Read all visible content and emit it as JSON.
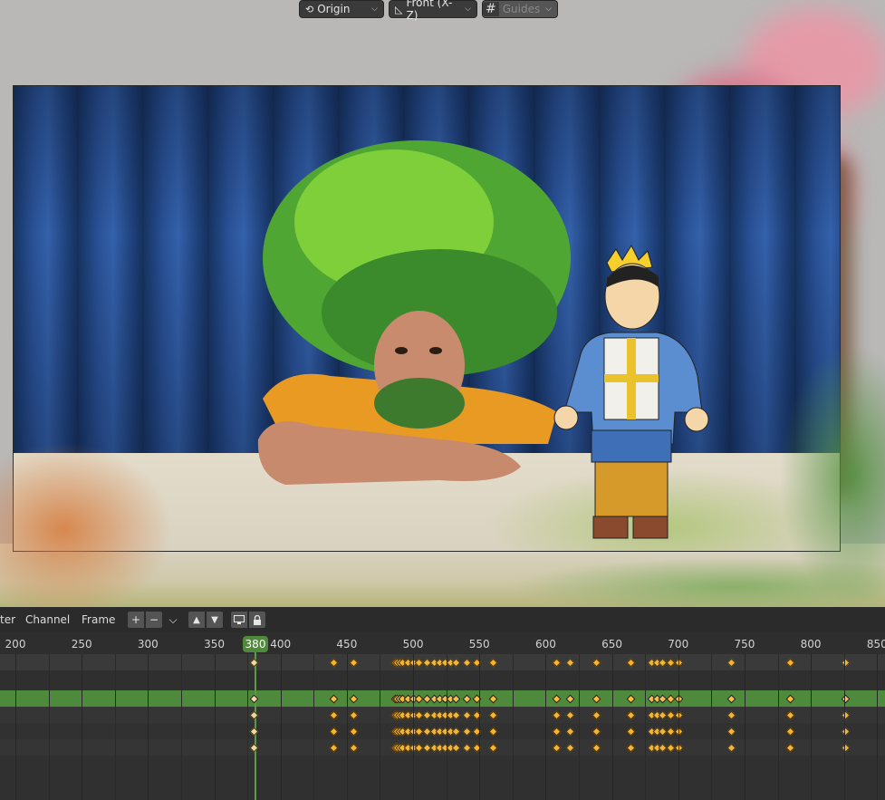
{
  "viewport_header": {
    "pivot_label": "Origin",
    "view_label": "Front (X-Z)",
    "guides_label": "Guides"
  },
  "timeline_header": {
    "menu_partial": "ter",
    "menu_channel": "Channel",
    "menu_frame": "Frame",
    "btn_add": "+",
    "btn_remove": "−",
    "btn_dropdown": "⌵",
    "btn_up": "▲",
    "btn_down": "▼"
  },
  "ruler": {
    "labels": [
      "200",
      "250",
      "300",
      "350",
      "400",
      "450",
      "500",
      "550",
      "600",
      "650",
      "700",
      "750",
      "800",
      "850"
    ],
    "current_frame": "380"
  },
  "keyframes": {
    "frames": [
      380,
      440,
      455,
      486,
      488,
      490,
      492,
      496,
      500,
      504,
      510,
      516,
      520,
      524,
      528,
      532,
      540,
      548,
      560,
      608,
      618,
      638,
      664,
      680,
      684,
      688,
      694,
      700,
      740,
      784,
      826
    ],
    "rows": [
      "summary",
      "empty",
      "selected",
      "channel-1",
      "channel-2",
      "channel-3"
    ]
  },
  "colors": {
    "accent_green": "#4f8a3c",
    "keyframe": "#f2b43a",
    "selected_row": "#4d8a3b"
  }
}
